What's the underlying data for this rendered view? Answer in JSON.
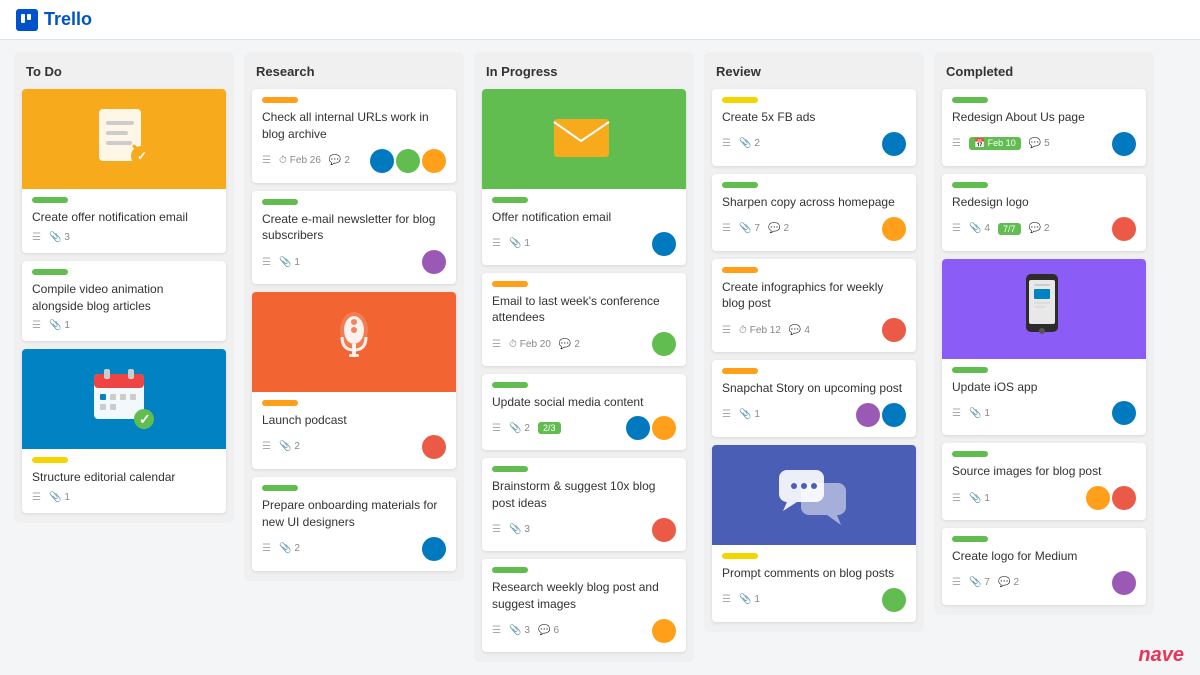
{
  "logo": {
    "icon": "☰",
    "text": "Trello"
  },
  "columns": [
    {
      "id": "todo",
      "title": "To Do",
      "cards": [
        {
          "id": "todo-1",
          "hasImage": true,
          "imageType": "todo-checklist",
          "imageColor": "#f6aa1c",
          "label": "green",
          "title": "Create offer notification email",
          "meta": {
            "list": true,
            "attachments": "3",
            "date": null,
            "comments": null
          },
          "avatars": []
        },
        {
          "id": "todo-2",
          "hasImage": false,
          "label": "green",
          "title": "Compile video animation alongside blog articles",
          "meta": {
            "list": true,
            "attachments": "1",
            "date": null,
            "comments": null
          },
          "avatars": []
        },
        {
          "id": "todo-3",
          "hasImage": true,
          "imageType": "todo-calendar",
          "imageColor": "#0082c3",
          "label": "yellow",
          "title": "Structure editorial calendar",
          "meta": {
            "list": true,
            "attachments": "1",
            "date": null,
            "comments": null
          },
          "avatars": []
        }
      ]
    },
    {
      "id": "research",
      "title": "Research",
      "cards": [
        {
          "id": "research-1",
          "hasImage": false,
          "label": "orange",
          "title": "Check all internal URLs work in blog archive",
          "meta": {
            "list": true,
            "date": "Feb 26",
            "attachments": null,
            "comments": "2"
          },
          "avatars": [
            "blue",
            "green",
            "orange"
          ]
        },
        {
          "id": "research-2",
          "hasImage": false,
          "label": "green",
          "title": "Create e-mail newsletter for blog subscribers",
          "meta": {
            "list": true,
            "attachments": "1",
            "date": null,
            "comments": null
          },
          "avatars": [
            "purple"
          ]
        },
        {
          "id": "research-3",
          "hasImage": true,
          "imageType": "research-microphone",
          "imageColor": "#f26533",
          "label": "orange",
          "title": "Launch podcast",
          "meta": {
            "list": true,
            "attachments": "2",
            "date": null,
            "comments": null
          },
          "avatars": [
            "red"
          ]
        },
        {
          "id": "research-4",
          "hasImage": false,
          "label": "green",
          "title": "Prepare onboarding materials for new UI designers",
          "meta": {
            "list": true,
            "attachments": "2",
            "date": null,
            "comments": null
          },
          "avatars": [
            "blue"
          ]
        }
      ]
    },
    {
      "id": "inprogress",
      "title": "In Progress",
      "cards": [
        {
          "id": "ip-1",
          "hasImage": true,
          "imageType": "ip-envelope",
          "imageColor": "#61bd4f",
          "label": "green",
          "title": "Offer notification email",
          "meta": {
            "list": true,
            "attachments": "1",
            "date": null,
            "comments": null
          },
          "avatars": [
            "blue"
          ]
        },
        {
          "id": "ip-2",
          "hasImage": false,
          "label": "orange",
          "title": "Email to last week's conference attendees",
          "meta": {
            "list": true,
            "date": "Feb 20",
            "attachments": null,
            "comments": "2"
          },
          "avatars": [
            "green"
          ]
        },
        {
          "id": "ip-3",
          "hasImage": false,
          "label": "green",
          "title": "Update social media content",
          "meta": {
            "list": true,
            "attachments": "2",
            "progress": "2/3",
            "comments": null
          },
          "avatars": [
            "blue",
            "orange"
          ]
        },
        {
          "id": "ip-4",
          "hasImage": false,
          "label": "green",
          "title": "Brainstorm & suggest 10x blog post ideas",
          "meta": {
            "list": true,
            "attachments": "3",
            "date": null,
            "comments": null
          },
          "avatars": [
            "red"
          ]
        },
        {
          "id": "ip-5",
          "hasImage": false,
          "label": "green",
          "title": "Research weekly blog post and suggest images",
          "meta": {
            "list": true,
            "attachments": "3",
            "comments": "6"
          },
          "avatars": [
            "orange"
          ]
        }
      ]
    },
    {
      "id": "review",
      "title": "Review",
      "cards": [
        {
          "id": "rev-1",
          "hasImage": false,
          "label": "yellow",
          "title": "Create 5x FB ads",
          "meta": {
            "list": true,
            "attachments": "2",
            "date": null,
            "comments": null
          },
          "avatars": [
            "blue"
          ]
        },
        {
          "id": "rev-2",
          "hasImage": false,
          "label": "green",
          "title": "Sharpen copy across homepage",
          "meta": {
            "list": true,
            "attachments": "7",
            "comments": "2"
          },
          "avatars": [
            "orange"
          ]
        },
        {
          "id": "rev-3",
          "hasImage": false,
          "label": "orange",
          "title": "Create infographics for weekly blog post",
          "meta": {
            "list": true,
            "date": "Feb 12",
            "attachments": null,
            "comments": "4"
          },
          "avatars": [
            "red"
          ]
        },
        {
          "id": "rev-4",
          "hasImage": false,
          "label": "orange",
          "title": "Snapchat Story on upcoming post",
          "meta": {
            "list": true,
            "attachments": "1",
            "date": null,
            "comments": null
          },
          "avatars": [
            "purple",
            "blue"
          ]
        },
        {
          "id": "rev-5",
          "hasImage": true,
          "imageType": "review-chat",
          "imageColor": "#4a5eb5",
          "label": "yellow",
          "title": "Prompt comments on blog posts",
          "meta": {
            "list": true,
            "attachments": "1",
            "date": null,
            "comments": null
          },
          "avatars": [
            "green"
          ]
        }
      ]
    },
    {
      "id": "completed",
      "title": "Completed",
      "cards": [
        {
          "id": "comp-1",
          "hasImage": false,
          "label": "green",
          "title": "Redesign About Us page",
          "meta": {
            "list": true,
            "date_badge": "Feb 10",
            "attachments": null,
            "comments": "5"
          },
          "avatars": [
            "blue"
          ]
        },
        {
          "id": "comp-2",
          "hasImage": false,
          "label": "green",
          "title": "Redesign logo",
          "meta": {
            "list": true,
            "attachments": "4",
            "comments": "2",
            "progress": "7/7"
          },
          "avatars": [
            "red"
          ]
        },
        {
          "id": "comp-3",
          "hasImage": true,
          "imageType": "comp-phone",
          "imageColor": "#8b5cf6",
          "label": "green",
          "title": "Update iOS app",
          "meta": {
            "list": true,
            "attachments": "1",
            "date": null,
            "comments": null
          },
          "avatars": [
            "blue"
          ]
        },
        {
          "id": "comp-4",
          "hasImage": false,
          "label": "green",
          "title": "Source images for blog post",
          "meta": {
            "list": true,
            "attachments": "1",
            "date": null,
            "comments": null
          },
          "avatars": [
            "orange",
            "red"
          ]
        },
        {
          "id": "comp-5",
          "hasImage": false,
          "label": "green",
          "title": "Create logo for Medium",
          "meta": {
            "list": true,
            "attachments": "7",
            "comments": "2"
          },
          "avatars": [
            "purple"
          ]
        }
      ]
    }
  ]
}
